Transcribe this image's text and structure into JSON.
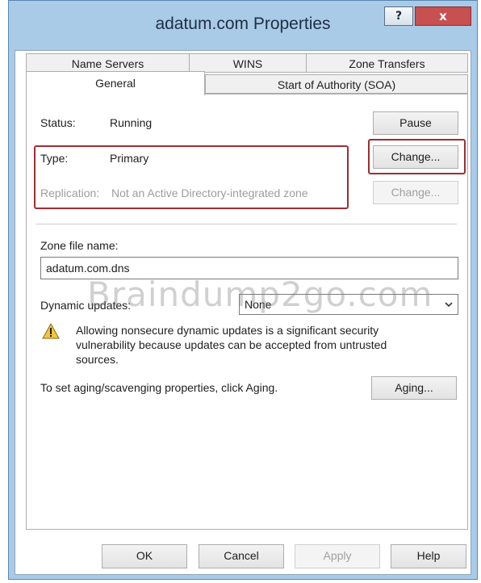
{
  "window": {
    "title": "adatum.com Properties",
    "help_label": "?",
    "close_label": "x"
  },
  "tabs": {
    "row_back": [
      "Name Servers",
      "WINS",
      "Zone Transfers"
    ],
    "row_front": [
      "General",
      "Start of Authority (SOA)"
    ],
    "selected": "General"
  },
  "general": {
    "status_label": "Status:",
    "status_value": "Running",
    "pause_label": "Pause",
    "type_label": "Type:",
    "type_value": "Primary",
    "type_change_label": "Change...",
    "replication_label": "Replication:",
    "replication_value": "Not an Active Directory-integrated zone",
    "replication_change_label": "Change...",
    "zone_file_label": "Zone file name:",
    "zone_file_value": "adatum.com.dns",
    "dynamic_updates_label": "Dynamic updates:",
    "dynamic_updates_value": "None",
    "warning_text": "Allowing nonsecure dynamic updates is a significant security vulnerability because updates can be accepted from untrusted sources.",
    "aging_text": "To set aging/scavenging properties, click Aging.",
    "aging_label": "Aging..."
  },
  "watermark": "Braindump2go.com",
  "footer": {
    "ok": "OK",
    "cancel": "Cancel",
    "apply": "Apply",
    "help": "Help"
  },
  "colors": {
    "highlight": "#9c2f33",
    "frame": "#a9cbe8",
    "close_button": "#c75050"
  }
}
